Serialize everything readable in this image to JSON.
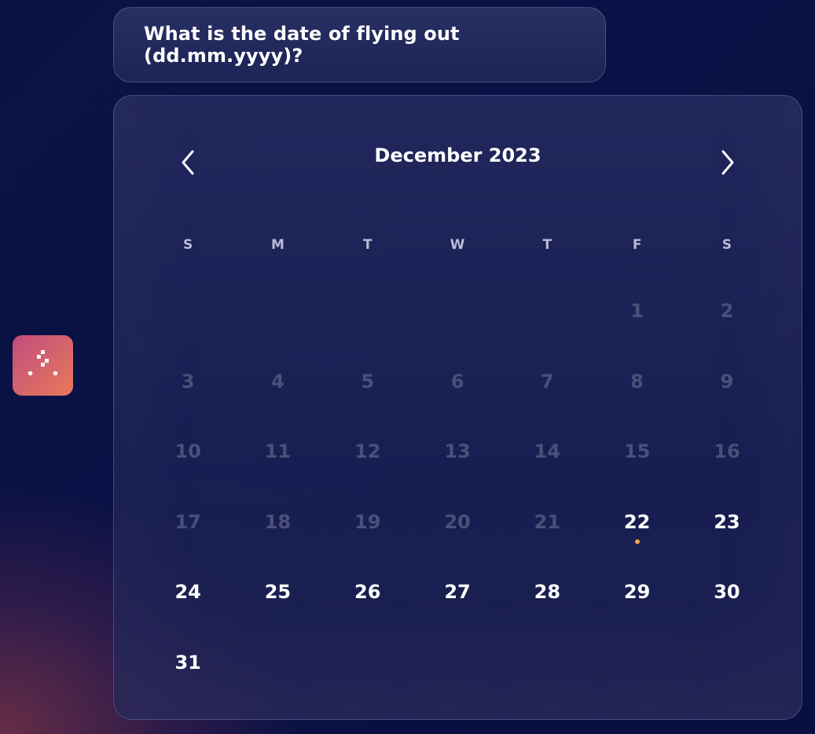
{
  "question": {
    "text": "What is the date of flying out (dd.mm.yyyy)?"
  },
  "calendar": {
    "month_label": "December 2023",
    "weekdays": [
      "S",
      "M",
      "T",
      "W",
      "T",
      "F",
      "S"
    ],
    "leading_blanks": 5,
    "days": [
      {
        "label": "1",
        "enabled": false
      },
      {
        "label": "2",
        "enabled": false
      },
      {
        "label": "3",
        "enabled": false
      },
      {
        "label": "4",
        "enabled": false
      },
      {
        "label": "5",
        "enabled": false
      },
      {
        "label": "6",
        "enabled": false
      },
      {
        "label": "7",
        "enabled": false
      },
      {
        "label": "8",
        "enabled": false
      },
      {
        "label": "9",
        "enabled": false
      },
      {
        "label": "10",
        "enabled": false
      },
      {
        "label": "11",
        "enabled": false
      },
      {
        "label": "12",
        "enabled": false
      },
      {
        "label": "13",
        "enabled": false
      },
      {
        "label": "14",
        "enabled": false
      },
      {
        "label": "15",
        "enabled": false
      },
      {
        "label": "16",
        "enabled": false
      },
      {
        "label": "17",
        "enabled": false
      },
      {
        "label": "18",
        "enabled": false
      },
      {
        "label": "19",
        "enabled": false
      },
      {
        "label": "20",
        "enabled": false
      },
      {
        "label": "21",
        "enabled": false
      },
      {
        "label": "22",
        "enabled": true,
        "today": true
      },
      {
        "label": "23",
        "enabled": true
      },
      {
        "label": "24",
        "enabled": true
      },
      {
        "label": "25",
        "enabled": true
      },
      {
        "label": "26",
        "enabled": true
      },
      {
        "label": "27",
        "enabled": true
      },
      {
        "label": "28",
        "enabled": true
      },
      {
        "label": "29",
        "enabled": true
      },
      {
        "label": "30",
        "enabled": true
      },
      {
        "label": "31",
        "enabled": true
      }
    ],
    "prev_icon": "chevron-left-icon",
    "next_icon": "chevron-right-icon"
  },
  "avatar": {
    "icon": "assistant-logo-icon"
  },
  "colors": {
    "today_dot": "#f0a64a",
    "disabled_day": "#4a5078",
    "enabled_day": "#ffffff",
    "avatar_gradient_start": "#c24d7d",
    "avatar_gradient_end": "#e8795a"
  }
}
